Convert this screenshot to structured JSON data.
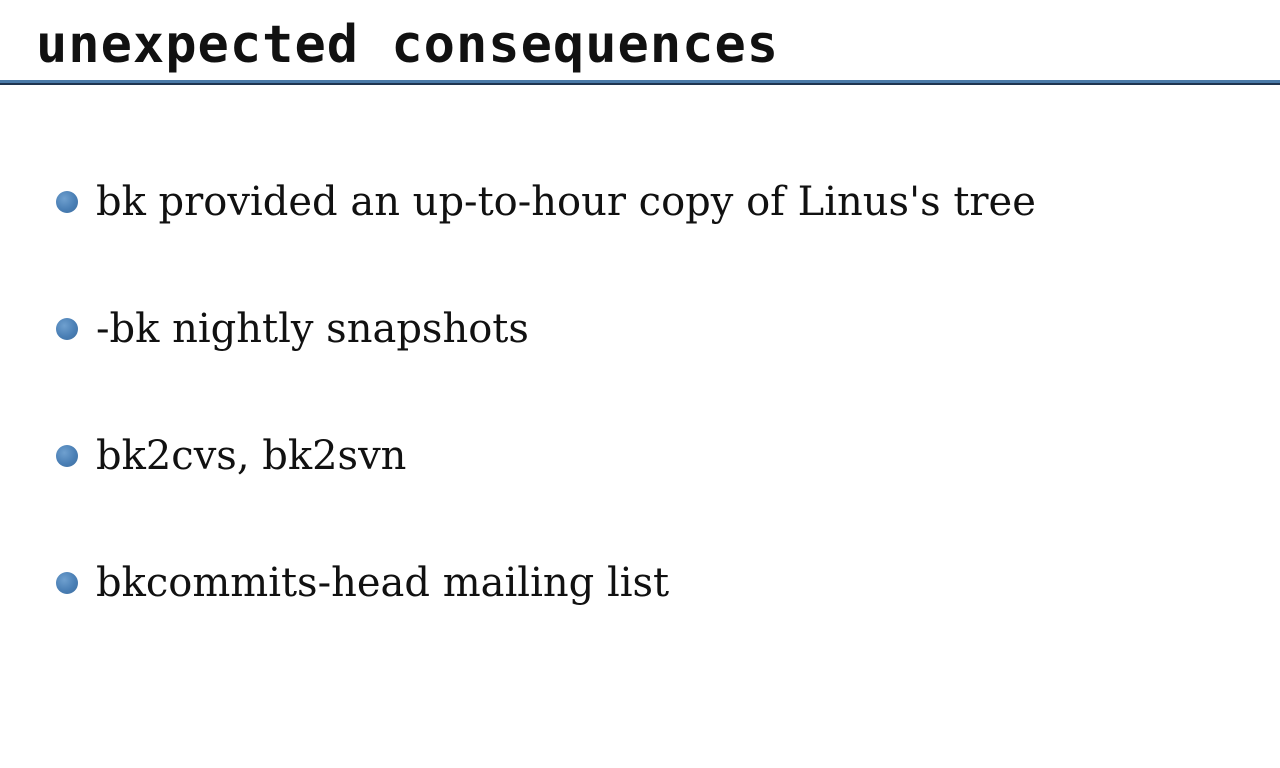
{
  "slide": {
    "title": "unexpected consequences",
    "accent_color": "#4a7fb5",
    "bullets": [
      {
        "text": "bk provided an up-to-hour copy of Linus's tree"
      },
      {
        "text": "-bk nightly snapshots"
      },
      {
        "text": "bk2cvs, bk2svn"
      },
      {
        "text": "bkcommits-head mailing list"
      }
    ]
  }
}
